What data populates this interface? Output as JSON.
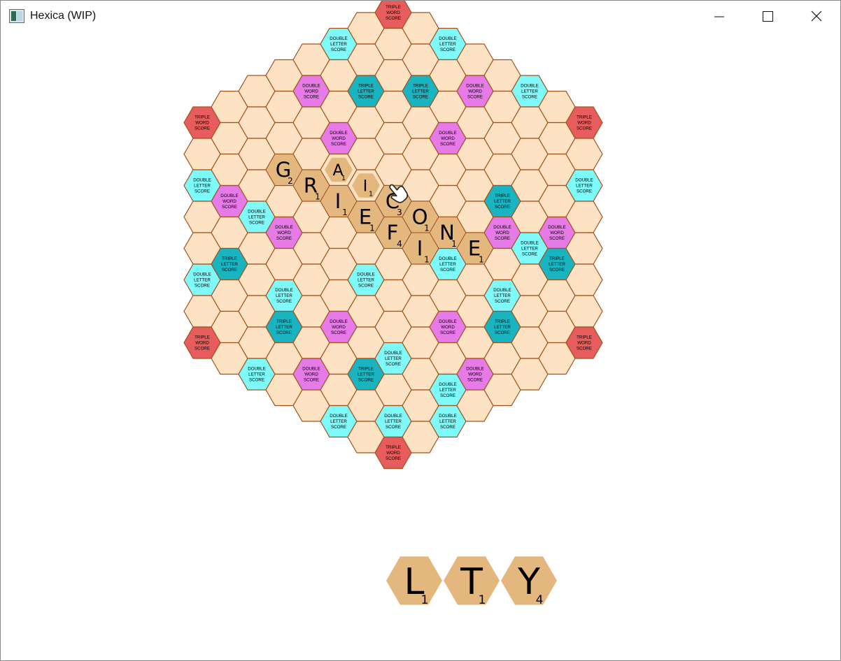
{
  "window": {
    "title": "Hexica (WIP)",
    "icon": "app-window-icon",
    "controls": [
      "minimize-icon",
      "maximize-icon",
      "close-icon"
    ]
  },
  "colors": {
    "cell": "#fde2c3",
    "cell_border": "#a4501a",
    "tile": "#e4b77f",
    "double_letter": "#7ffafa",
    "triple_letter": "#1ab3c0",
    "double_word": "#e67ae6",
    "triple_word": "#e75d5d"
  },
  "premium_labels": {
    "DL": [
      "DOUBLE",
      "LETTER",
      "SCORE"
    ],
    "TL": [
      "TRIPLE",
      "LETTER",
      "SCORE"
    ],
    "DW": [
      "DOUBLE",
      "WORD",
      "SCORE"
    ],
    "TW": [
      "TRIPLE",
      "WORD",
      "SCORE"
    ]
  },
  "premium_cells": [
    {
      "q": 0,
      "r": -7,
      "type": "TW"
    },
    {
      "q": 7,
      "r": -7,
      "type": "TW"
    },
    {
      "q": 7,
      "r": 0,
      "type": "TW"
    },
    {
      "q": 0,
      "r": 7,
      "type": "TW"
    },
    {
      "q": -7,
      "r": 7,
      "type": "TW"
    },
    {
      "q": -7,
      "r": 0,
      "type": "TW"
    },
    {
      "q": -2,
      "r": -5,
      "type": "DL"
    },
    {
      "q": 2,
      "r": -7,
      "type": "DL"
    },
    {
      "q": 5,
      "r": -7,
      "type": "DL"
    },
    {
      "q": 7,
      "r": -5,
      "type": "DL"
    },
    {
      "q": 5,
      "r": -2,
      "type": "DL"
    },
    {
      "q": -5,
      "r": 7,
      "type": "DL"
    },
    {
      "q": -2,
      "r": 7,
      "type": "DL"
    },
    {
      "q": 2,
      "r": 5,
      "type": "DL"
    },
    {
      "q": -5,
      "r": 2,
      "type": "DL"
    },
    {
      "q": -7,
      "r": 2,
      "type": "DL"
    },
    {
      "q": -7,
      "r": 5,
      "type": "DL"
    },
    {
      "q": 0,
      "r": -1,
      "type": "DL"
    },
    {
      "q": 0,
      "r": 0,
      "type": "DL"
    },
    {
      "q": -1,
      "r": 2,
      "type": "DL"
    },
    {
      "q": 2,
      "r": 0,
      "type": "DL"
    },
    {
      "q": -4,
      "r": 4,
      "type": "DL"
    },
    {
      "q": -2,
      "r": 4,
      "type": "DL"
    },
    {
      "q": 0,
      "r": 4,
      "type": "DL"
    },
    {
      "q": 2,
      "r": 2,
      "type": "DL"
    },
    {
      "q": 4,
      "r": 0,
      "type": "DL"
    },
    {
      "q": 0,
      "r": 6,
      "type": "DL"
    },
    {
      "q": 2,
      "r": 4,
      "type": "DL"
    },
    {
      "q": -1,
      "r": -4,
      "type": "TL"
    },
    {
      "q": 1,
      "r": -5,
      "type": "TL"
    },
    {
      "q": 4,
      "r": -3,
      "type": "TL"
    },
    {
      "q": -6,
      "r": 4,
      "type": "TL"
    },
    {
      "q": 6,
      "r": -2,
      "type": "TL"
    },
    {
      "q": -4,
      "r": 5,
      "type": "TL"
    },
    {
      "q": 4,
      "r": 1,
      "type": "TL"
    },
    {
      "q": -1,
      "r": 5,
      "type": "TL"
    },
    {
      "q": -3,
      "r": -3,
      "type": "DW"
    },
    {
      "q": 3,
      "r": -6,
      "type": "DW"
    },
    {
      "q": -2,
      "r": -2,
      "type": "DW"
    },
    {
      "q": 2,
      "r": -4,
      "type": "DW"
    },
    {
      "q": -6,
      "r": 2,
      "type": "DW"
    },
    {
      "q": -4,
      "r": 2,
      "type": "DW"
    },
    {
      "q": 4,
      "r": -2,
      "type": "DW"
    },
    {
      "q": 6,
      "r": -3,
      "type": "DW"
    },
    {
      "q": -2,
      "r": 4,
      "type": "DW"
    },
    {
      "q": 2,
      "r": 2,
      "type": "DW"
    },
    {
      "q": -3,
      "r": 6,
      "type": "DW"
    },
    {
      "q": 3,
      "r": 3,
      "type": "DW"
    }
  ],
  "board_tiles": [
    {
      "q": -1,
      "r": -1,
      "letter": "I",
      "score": "1",
      "small": true
    },
    {
      "q": -2,
      "r": -1,
      "letter": "A",
      "score": "1",
      "small": true
    },
    {
      "q": 0,
      "r": -1,
      "letter": "C",
      "score": "3"
    },
    {
      "q": -4,
      "r": 0,
      "letter": "G",
      "score": "2"
    },
    {
      "q": -3,
      "r": 0,
      "letter": "R",
      "score": "1"
    },
    {
      "q": -2,
      "r": 0,
      "letter": "I",
      "score": "1"
    },
    {
      "q": -1,
      "r": 0,
      "letter": "E",
      "score": "1"
    },
    {
      "q": 0,
      "r": 0,
      "letter": "F",
      "score": "4"
    },
    {
      "q": 1,
      "r": -1,
      "letter": "O",
      "score": "1"
    },
    {
      "q": 1,
      "r": 0,
      "letter": "I",
      "score": "1"
    },
    {
      "q": 2,
      "r": -1,
      "letter": "N",
      "score": "1"
    },
    {
      "q": 3,
      "r": -1,
      "letter": "E",
      "score": "1"
    }
  ],
  "rack": [
    {
      "letter": "L",
      "score": "1"
    },
    {
      "letter": "T",
      "score": "1"
    },
    {
      "letter": "Y",
      "score": "4"
    }
  ],
  "cursor": "hand-pointer-icon"
}
